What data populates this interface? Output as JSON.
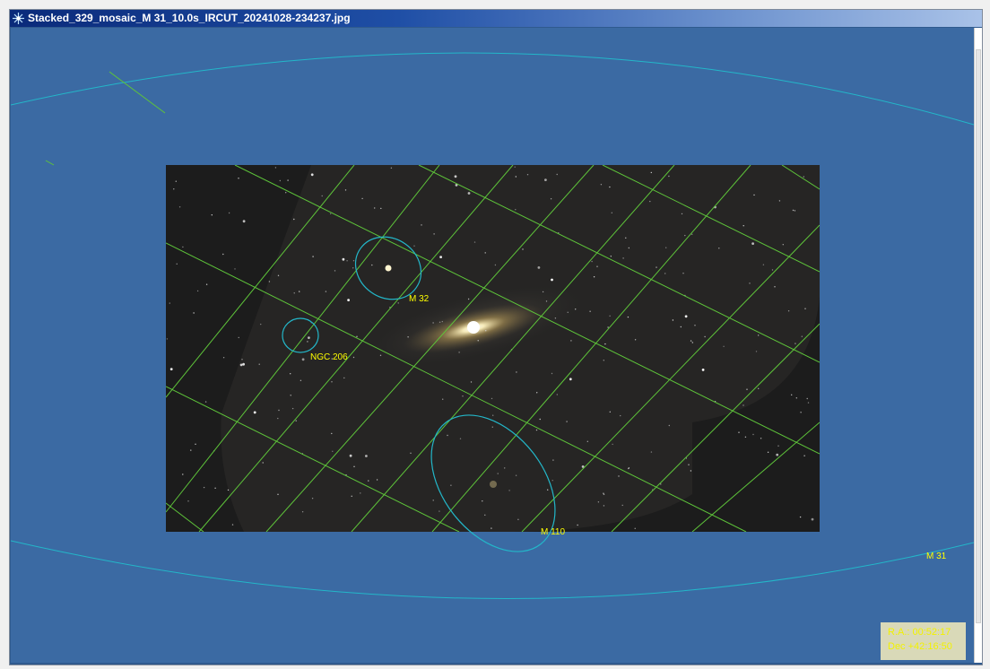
{
  "window": {
    "title": "Stacked_329_mosaic_M 31_10.0s_IRCUT_20241028-234237.jpg",
    "app_icon": "star-burst-icon"
  },
  "sky_map": {
    "objects": [
      {
        "id": "m32",
        "label": "M 32"
      },
      {
        "id": "ngc206",
        "label": "NGC 206"
      },
      {
        "id": "m110",
        "label": "M 110"
      },
      {
        "id": "m31",
        "label": "M 31"
      }
    ],
    "colors": {
      "background": "#3b6aa3",
      "image_background": "#1c1c1c",
      "grid": "#5ec43a",
      "outline": "#23b7c9",
      "label": "#ffff00"
    }
  },
  "coordinates": {
    "ra": "R.A.:  00:52:17",
    "dec": "Dec +42:16:50"
  }
}
